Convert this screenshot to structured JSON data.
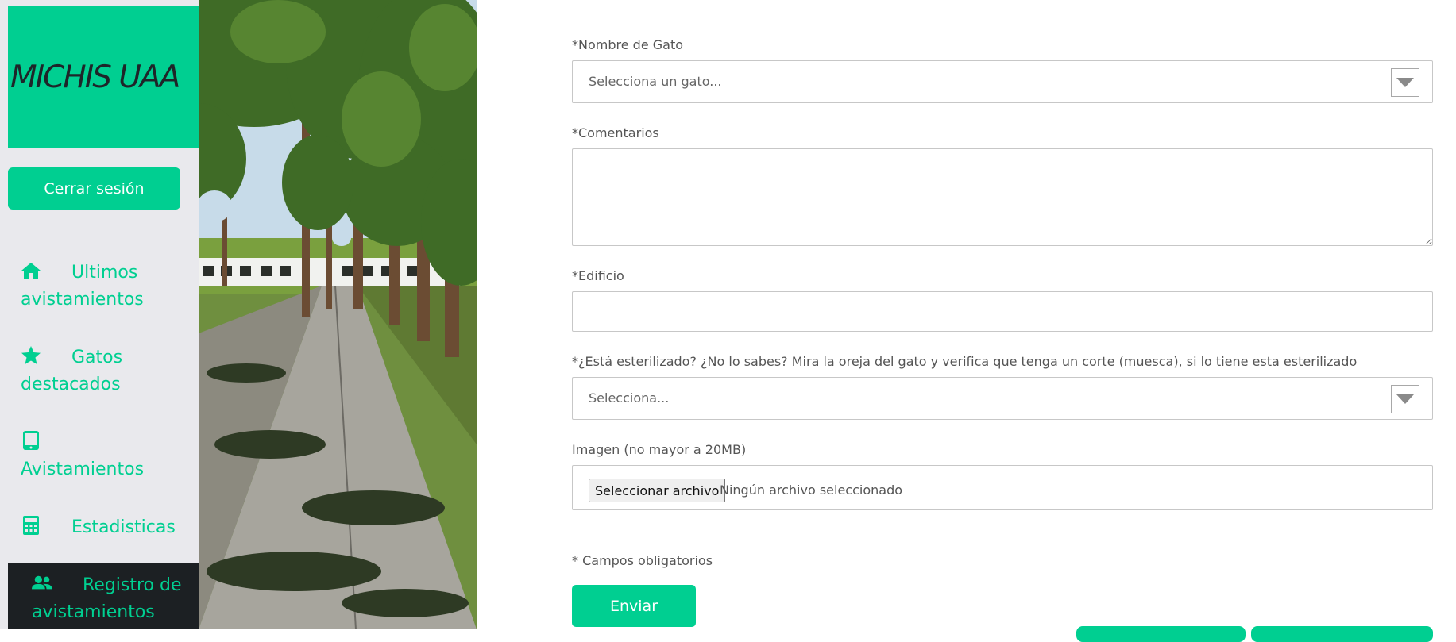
{
  "sidebar": {
    "logo": "MICHIS UAA",
    "logout_label": "Cerrar sesión",
    "items": [
      {
        "label": "Ultimos avistamientos",
        "icon": "home-icon"
      },
      {
        "label": "Gatos destacados",
        "icon": "star-icon"
      },
      {
        "label": "Avistamientos",
        "icon": "tablet-icon"
      },
      {
        "label": "Estadisticas",
        "icon": "calculator-icon"
      },
      {
        "label": "Registro de avistamientos",
        "icon": "users-icon",
        "active": true
      }
    ]
  },
  "form": {
    "cat_name": {
      "label": "*Nombre de Gato",
      "placeholder": "Selecciona un gato..."
    },
    "comments": {
      "label": "*Comentarios",
      "value": ""
    },
    "building": {
      "label": "*Edificio",
      "value": ""
    },
    "sterilized": {
      "label": "*¿Está esterilizado? ¿No lo sabes? Mira la oreja del gato y verifica que tenga un corte (muesca), si lo tiene esta esterilizado",
      "placeholder": "Selecciona..."
    },
    "image": {
      "label": "Imagen (no mayor a 20MB)",
      "button_label": "Seleccionar archivo",
      "status": "Ningún archivo seleccionado"
    },
    "required_note": "* Campos obligatorios",
    "submit_label": "Enviar"
  },
  "colors": {
    "accent": "#00cf91",
    "sidebar_bg": "#e9e9ed",
    "active_bg": "#1c2023"
  }
}
